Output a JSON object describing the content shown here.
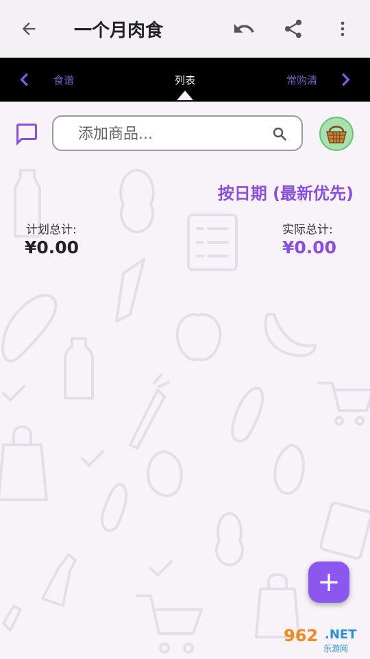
{
  "header": {
    "title": "一个月肉食",
    "back_icon": "back-arrow-icon",
    "undo_icon": "undo-icon",
    "share_icon": "share-icon",
    "more_icon": "more-vert-icon"
  },
  "tabs": {
    "left": "食谱",
    "center": "列表",
    "right": "常购清"
  },
  "search": {
    "placeholder": "添加商品..."
  },
  "sort_label": "按日期 (最新优先)",
  "totals": {
    "planned_label": "计划总计:",
    "planned_value": "¥0.00",
    "actual_label": "实际总计:",
    "actual_value": "¥0.00"
  },
  "fab_label": "+",
  "watermark": {
    "brand": "962",
    "suffix": ".NET",
    "subtitle": "乐游网"
  },
  "colors": {
    "accent": "#8a4fe0",
    "tabbar": "#000000",
    "background": "#f7f3f8",
    "basket_bg": "#a8e0b0"
  }
}
